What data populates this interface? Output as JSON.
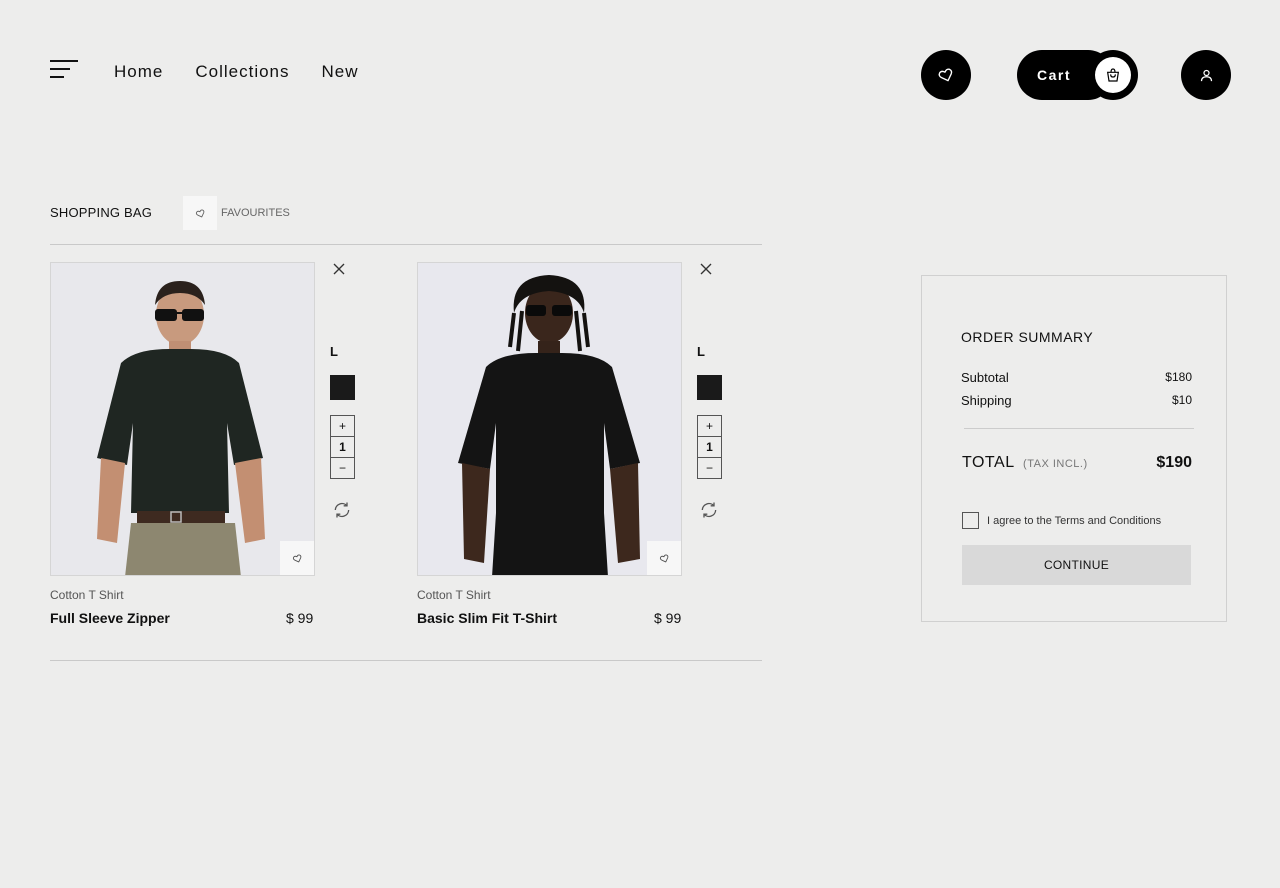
{
  "nav": {
    "links": [
      "Home",
      "Collections",
      "New"
    ],
    "cart_label": "Cart"
  },
  "tabs": {
    "bag": "SHOPPING BAG",
    "favourites": "FAVOURITES"
  },
  "products": [
    {
      "category": "Cotton T Shirt",
      "name": "Full Sleeve Zipper",
      "price": "$ 99",
      "size": "L",
      "quantity": "1",
      "color": "#1a1a1a"
    },
    {
      "category": "Cotton T Shirt",
      "name": "Basic Slim Fit T-Shirt",
      "price": "$ 99",
      "size": "L",
      "quantity": "1",
      "color": "#1a1a1a"
    }
  ],
  "summary": {
    "title": "ORDER SUMMARY",
    "subtotal_label": "Subtotal",
    "subtotal": "$180",
    "shipping_label": "Shipping",
    "shipping": "$10",
    "total_label": "TOTAL",
    "tax_note": "(TAX INCL.)",
    "total": "$190",
    "terms": "I agree to the Terms and Conditions",
    "continue_label": "CONTINUE"
  },
  "stepper": {
    "plus": "+",
    "minus": "−"
  },
  "icons": {
    "menu": "menu-icon",
    "favourite": "heart-icon",
    "cart": "shopping-bag-icon",
    "user": "user-icon",
    "remove": "close-icon",
    "refresh": "refresh-icon"
  },
  "colors": {
    "accent": "#000000",
    "background": "#ededec",
    "button": "#d9d9d9"
  }
}
